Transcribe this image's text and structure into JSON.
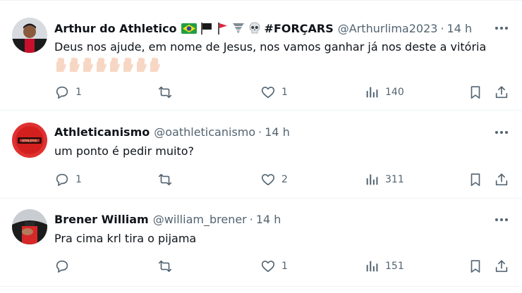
{
  "tweets": [
    {
      "name": "Arthur do Athletico",
      "tag": "#FORÇARS",
      "handle": "@Arthurlima2023",
      "time": "14 h",
      "text": "Deus nos ajude, em nome de Jesus, nos vamos ganhar já nos deste a vitória",
      "emojis": [
        "brazil-flag",
        "black-flag",
        "red-flag",
        "tornado",
        "skull"
      ],
      "hands_count": 8,
      "replies": "1",
      "retweets": "",
      "likes": "1",
      "views": "140"
    },
    {
      "name": "Athleticanismo",
      "handle": "@oathleticanismo",
      "time": "14 h",
      "text": "um ponto é pedir muito?",
      "replies": "1",
      "retweets": "",
      "likes": "2",
      "views": "311"
    },
    {
      "name": "Brener William",
      "handle": "@william_brener",
      "time": "14 h",
      "text": "Pra cima krl tira o pijama",
      "replies": "",
      "retweets": "",
      "likes": "1",
      "views": "151"
    }
  ],
  "separator": "·",
  "colors": {
    "text": "#0f1419",
    "muted": "#536471",
    "border": "#eff3f4"
  }
}
